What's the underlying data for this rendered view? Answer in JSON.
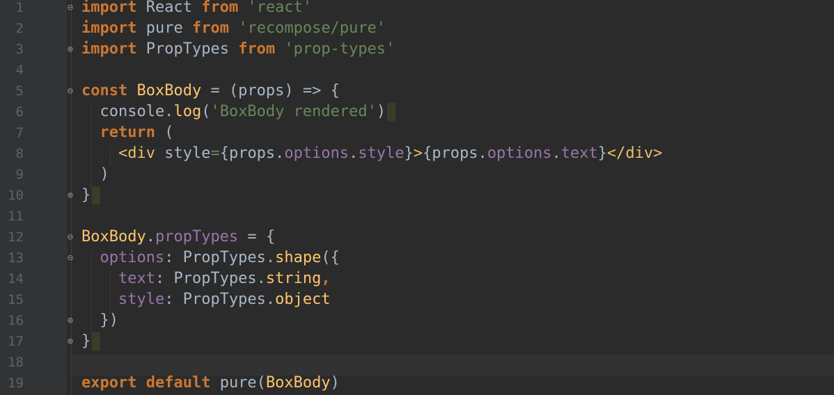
{
  "editor": {
    "language": "javascript",
    "colors": {
      "background": "#2b2b2b",
      "gutter": "#313335",
      "keyword": "#cc7832",
      "string": "#6a8759",
      "function": "#ffc66d",
      "property": "#9876aa",
      "tag": "#e8bf6a",
      "plain": "#a9b7c6",
      "line_number": "#606366"
    },
    "current_line": 18,
    "lines": [
      {
        "n": "1",
        "fold": "open",
        "tokens": [
          [
            "kw",
            "import"
          ],
          [
            "pl",
            " React "
          ],
          [
            "kw",
            "from"
          ],
          [
            "pl",
            " "
          ],
          [
            "str",
            "'react'"
          ]
        ]
      },
      {
        "n": "2",
        "tokens": [
          [
            "kw",
            "import"
          ],
          [
            "pl",
            " pure "
          ],
          [
            "kw",
            "from"
          ],
          [
            "pl",
            " "
          ],
          [
            "str",
            "'recompose/pure'"
          ]
        ]
      },
      {
        "n": "3",
        "fold": "close",
        "tokens": [
          [
            "kw",
            "import"
          ],
          [
            "pl",
            " PropTypes "
          ],
          [
            "kw",
            "from"
          ],
          [
            "pl",
            " "
          ],
          [
            "str",
            "'prop-types'"
          ]
        ]
      },
      {
        "n": "4",
        "tokens": []
      },
      {
        "n": "5",
        "fold": "open",
        "tokens": [
          [
            "kw",
            "const"
          ],
          [
            "pl",
            " "
          ],
          [
            "fn",
            "BoxBody"
          ],
          [
            "pl",
            " = (props) => {"
          ]
        ]
      },
      {
        "n": "6",
        "tokens": [
          [
            "pl",
            "  console."
          ],
          [
            "fn",
            "log"
          ],
          [
            "pl",
            "("
          ],
          [
            "str",
            "'BoxBody rendered'"
          ],
          [
            "pl",
            ")"
          ]
        ],
        "caret": true
      },
      {
        "n": "7",
        "tokens": [
          [
            "pl",
            "  "
          ],
          [
            "kw",
            "return"
          ],
          [
            "pl",
            " ("
          ]
        ]
      },
      {
        "n": "8",
        "tokens": [
          [
            "pl",
            "    "
          ],
          [
            "tag",
            "<div"
          ],
          [
            "pl",
            " style"
          ],
          [
            "str",
            "="
          ],
          [
            "pl",
            "{props."
          ],
          [
            "prop",
            "options"
          ],
          [
            "pl",
            "."
          ],
          [
            "prop",
            "style"
          ],
          [
            "pl",
            "}"
          ],
          [
            "tag",
            ">"
          ],
          [
            "pl",
            "{props."
          ],
          [
            "prop",
            "options"
          ],
          [
            "pl",
            "."
          ],
          [
            "prop",
            "text"
          ],
          [
            "pl",
            "}"
          ],
          [
            "tag",
            "</div>"
          ]
        ]
      },
      {
        "n": "9",
        "tokens": [
          [
            "pl",
            "  )"
          ]
        ]
      },
      {
        "n": "10",
        "fold": "close",
        "tokens": [
          [
            "pl",
            "}"
          ]
        ],
        "caret": true
      },
      {
        "n": "11",
        "tokens": []
      },
      {
        "n": "12",
        "fold": "open",
        "tokens": [
          [
            "fn",
            "BoxBody"
          ],
          [
            "pl",
            "."
          ],
          [
            "prop",
            "propTypes"
          ],
          [
            "pl",
            " = {"
          ]
        ]
      },
      {
        "n": "13",
        "fold": "open",
        "tokens": [
          [
            "pl",
            "  "
          ],
          [
            "prop",
            "options"
          ],
          [
            "pl",
            ": PropTypes."
          ],
          [
            "fn",
            "shape"
          ],
          [
            "pl",
            "({"
          ]
        ]
      },
      {
        "n": "14",
        "tokens": [
          [
            "pl",
            "    "
          ],
          [
            "prop",
            "text"
          ],
          [
            "pl",
            ": PropTypes."
          ],
          [
            "fn",
            "string"
          ],
          [
            "kw",
            ","
          ]
        ]
      },
      {
        "n": "15",
        "tokens": [
          [
            "pl",
            "    "
          ],
          [
            "prop",
            "style"
          ],
          [
            "pl",
            ": PropTypes."
          ],
          [
            "fn",
            "object"
          ]
        ]
      },
      {
        "n": "16",
        "fold": "close",
        "tokens": [
          [
            "pl",
            "  })"
          ]
        ]
      },
      {
        "n": "17",
        "fold": "close",
        "tokens": [
          [
            "pl",
            "}"
          ]
        ],
        "caret": true
      },
      {
        "n": "18",
        "tokens": []
      },
      {
        "n": "19",
        "tokens": [
          [
            "kw",
            "export"
          ],
          [
            "pl",
            " "
          ],
          [
            "kw",
            "default"
          ],
          [
            "pl",
            " pure("
          ],
          [
            "fn",
            "BoxBody"
          ],
          [
            "pl",
            ")"
          ]
        ]
      }
    ]
  }
}
